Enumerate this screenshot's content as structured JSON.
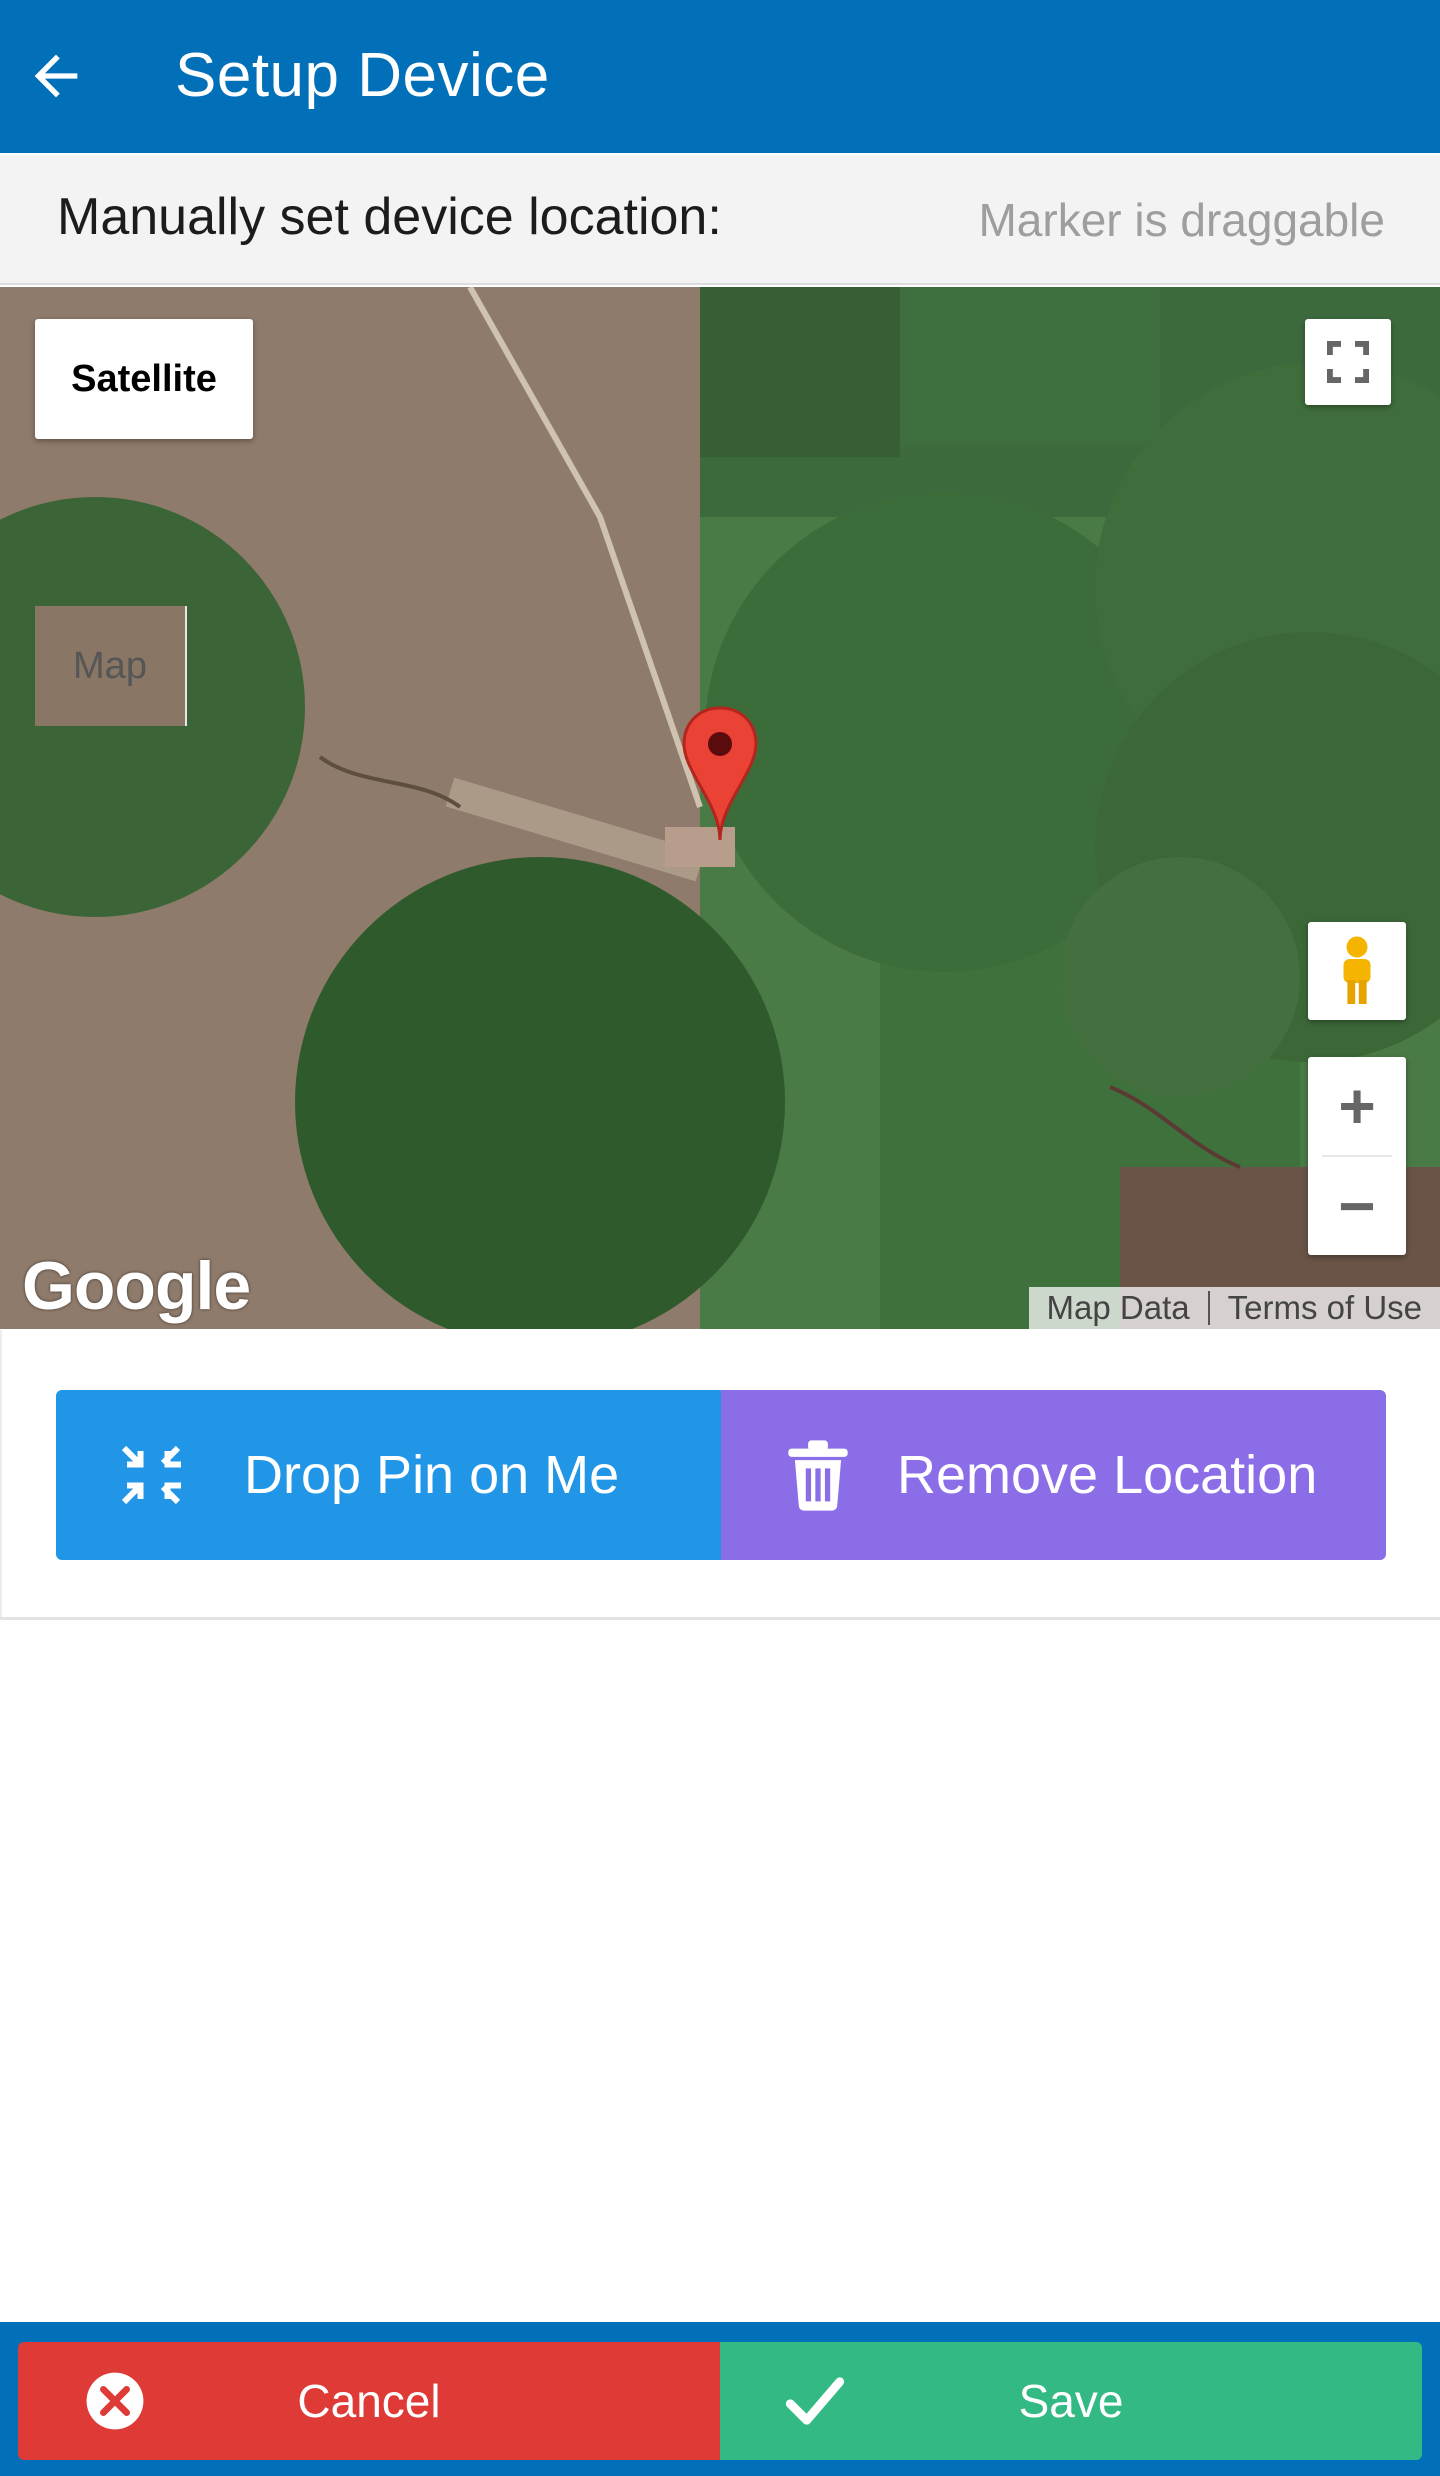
{
  "app_bar": {
    "title": "Setup Device",
    "back_icon": "arrow-left-icon"
  },
  "location_header": {
    "title": "Manually set device location:",
    "hint": "Marker is draggable"
  },
  "map": {
    "type_options": [
      "Map",
      "Satellite"
    ],
    "selected_type": "Satellite",
    "fullscreen_icon": "fullscreen-icon",
    "pegman_icon": "pegman-icon",
    "zoom_in": "+",
    "zoom_out": "−",
    "logo": "Google",
    "attribution": {
      "map_data": "Map Data",
      "terms": "Terms of Use"
    },
    "marker_icon": "map-pin-icon"
  },
  "actions": {
    "drop_pin_label": "Drop Pin on Me",
    "drop_pin_icon": "compress-arrows-icon",
    "remove_label": "Remove Location",
    "remove_icon": "trash-icon",
    "drop_color": "#2296e6",
    "remove_color": "#8b6de8"
  },
  "footer": {
    "cancel_label": "Cancel",
    "cancel_icon": "close-circle-icon",
    "save_label": "Save",
    "save_icon": "check-icon",
    "cancel_color": "#de3a36",
    "save_color": "#33b983"
  },
  "colors": {
    "primary": "#0270b8"
  }
}
